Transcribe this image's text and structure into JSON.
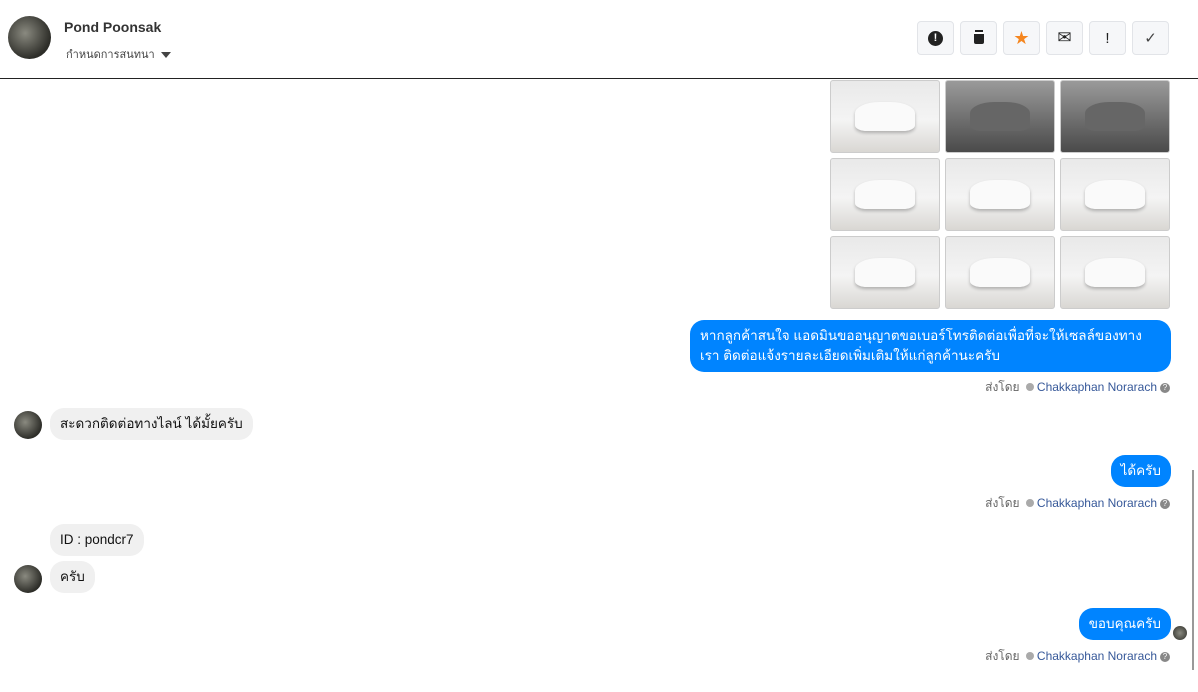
{
  "header": {
    "name": "Pond Poonsak",
    "subtitle": "กำหนดการสนทนา"
  },
  "toolbar": [
    {
      "name": "alert-button",
      "icon": "alert-circle-icon",
      "glyph": "❗"
    },
    {
      "name": "delete-button",
      "icon": "trash-icon",
      "glyph": "🗑"
    },
    {
      "name": "star-button",
      "icon": "star-icon",
      "glyph": "★"
    },
    {
      "name": "mail-button",
      "icon": "envelope-icon",
      "glyph": "✉"
    },
    {
      "name": "important-button",
      "icon": "exclamation-icon",
      "glyph": "!"
    },
    {
      "name": "done-button",
      "icon": "check-icon",
      "glyph": "✓"
    }
  ],
  "messages": {
    "out1": "หากลูกค้าสนใจ แอดมินขออนุญาตขอเบอร์โทรติดต่อเพื่อที่จะให้เซลล์ของทางเรา ติดต่อแจ้งรายละเอียดเพิ่มเติมให้แก่ลูกค้านะครับ",
    "in1": "สะดวกติดต่อทางไลน์ ได้มั้ยครับ",
    "out2": "ได้ครับ",
    "in2": "ID : pondcr7",
    "in3": "ครับ",
    "out3": "ขอบคุณครับ"
  },
  "sent_by": {
    "label": "ส่งโดย",
    "agent": "Chakkaphan Norarach",
    "help": "?"
  },
  "colors": {
    "accent": "#0084ff",
    "star": "#f5861f"
  }
}
